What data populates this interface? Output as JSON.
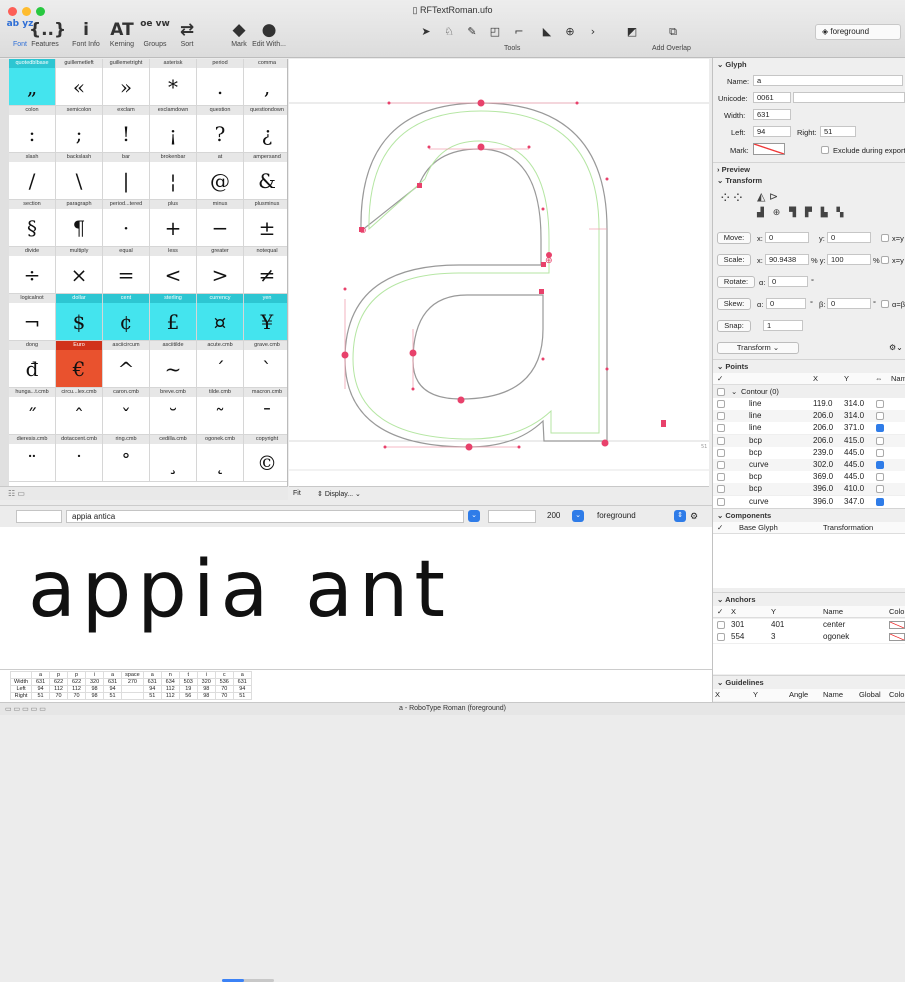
{
  "window": {
    "title": "RFTextRoman.ufo"
  },
  "toolbar": {
    "buttons": [
      {
        "label": "Font",
        "icon_text": "ab yz"
      },
      {
        "label": "Features",
        "icon_text": "{..}"
      },
      {
        "label": "Font Info",
        "icon_text": "i"
      },
      {
        "label": "Kerning",
        "icon_text": "AT"
      },
      {
        "label": "Groups",
        "icon_text": "oe vw"
      },
      {
        "label": "Sort",
        "icon_text": "⇄"
      },
      {
        "label": "Mark",
        "icon_text": "◆"
      },
      {
        "label": "Edit With...",
        "icon_text": "●"
      }
    ],
    "tools_label": "Tools",
    "add_overlap_label": "Add Overlap",
    "layer": "foreground"
  },
  "glyph_cells": [
    {
      "name": "quotedblbase",
      "glyph": "„",
      "mark": "cyan"
    },
    {
      "name": "guillemetleft",
      "glyph": "«"
    },
    {
      "name": "guillemetright",
      "glyph": "»"
    },
    {
      "name": "asterisk",
      "glyph": "*"
    },
    {
      "name": "period",
      "glyph": "."
    },
    {
      "name": "comma",
      "glyph": ","
    },
    {
      "name": "colon",
      "glyph": ":"
    },
    {
      "name": "semicolon",
      "glyph": ";"
    },
    {
      "name": "exclam",
      "glyph": "!"
    },
    {
      "name": "exclamdown",
      "glyph": "¡"
    },
    {
      "name": "question",
      "glyph": "?"
    },
    {
      "name": "questiondown",
      "glyph": "¿"
    },
    {
      "name": "slash",
      "glyph": "/"
    },
    {
      "name": "backslash",
      "glyph": "\\"
    },
    {
      "name": "bar",
      "glyph": "|"
    },
    {
      "name": "brokenbar",
      "glyph": "¦"
    },
    {
      "name": "at",
      "glyph": "@"
    },
    {
      "name": "ampersand",
      "glyph": "&"
    },
    {
      "name": "section",
      "glyph": "§"
    },
    {
      "name": "paragraph",
      "glyph": "¶"
    },
    {
      "name": "period...tered",
      "glyph": "·"
    },
    {
      "name": "plus",
      "glyph": "+"
    },
    {
      "name": "minus",
      "glyph": "−"
    },
    {
      "name": "plusminus",
      "glyph": "±"
    },
    {
      "name": "divide",
      "glyph": "÷"
    },
    {
      "name": "multiply",
      "glyph": "×"
    },
    {
      "name": "equal",
      "glyph": "="
    },
    {
      "name": "less",
      "glyph": "<"
    },
    {
      "name": "greater",
      "glyph": ">"
    },
    {
      "name": "notequal",
      "glyph": "≠"
    },
    {
      "name": "logicalnot",
      "glyph": "¬"
    },
    {
      "name": "dollar",
      "glyph": "$",
      "mark": "cyan"
    },
    {
      "name": "cent",
      "glyph": "¢",
      "mark": "cyan"
    },
    {
      "name": "sterling",
      "glyph": "£",
      "mark": "cyan"
    },
    {
      "name": "currency",
      "glyph": "¤",
      "mark": "cyan"
    },
    {
      "name": "yen",
      "glyph": "¥",
      "mark": "cyan"
    },
    {
      "name": "dong",
      "glyph": "đ"
    },
    {
      "name": "Euro",
      "glyph": "€",
      "mark": "red"
    },
    {
      "name": "asciicircum",
      "glyph": "^"
    },
    {
      "name": "asciitilde",
      "glyph": "~"
    },
    {
      "name": "acute.cmb",
      "glyph": "ˊ"
    },
    {
      "name": "grave.cmb",
      "glyph": "ˋ"
    },
    {
      "name": "hunga...t.cmb",
      "glyph": "˝"
    },
    {
      "name": "circu...lex.cmb",
      "glyph": "ˆ"
    },
    {
      "name": "caron.cmb",
      "glyph": "ˇ"
    },
    {
      "name": "breve.cmb",
      "glyph": "˘"
    },
    {
      "name": "tilde.cmb",
      "glyph": "˜"
    },
    {
      "name": "macron.cmb",
      "glyph": "¯"
    },
    {
      "name": "dieresis.cmb",
      "glyph": "¨"
    },
    {
      "name": "dotaccent.cmb",
      "glyph": "˙"
    },
    {
      "name": "ring.cmb",
      "glyph": "˚"
    },
    {
      "name": "cedilla.cmb",
      "glyph": "¸"
    },
    {
      "name": "ogonek.cmb",
      "glyph": "˛"
    },
    {
      "name": "copyright",
      "glyph": "©"
    }
  ],
  "canvas_footer": {
    "fit": "Fit",
    "display": "Display..."
  },
  "spacecenter": {
    "text": "appia antica",
    "size": "200",
    "layer": "foreground",
    "preview": "appia ant"
  },
  "metrics_table": {
    "glyphs": [
      "",
      "a",
      "p",
      "p",
      "i",
      "a",
      "space",
      "a",
      "n",
      "t",
      "i",
      "c",
      "a"
    ],
    "rows": [
      [
        "Width",
        "631",
        "622",
        "622",
        "320",
        "631",
        "270",
        "631",
        "634",
        "503",
        "320",
        "536",
        "631"
      ],
      [
        "Left",
        "94",
        "112",
        "112",
        "98",
        "94",
        "",
        "94",
        "112",
        "19",
        "98",
        "70",
        "94"
      ],
      [
        "Right",
        "51",
        "70",
        "70",
        "98",
        "51",
        "",
        "51",
        "112",
        "56",
        "98",
        "70",
        "51"
      ]
    ]
  },
  "status": "a - RoboType Roman (foreground)",
  "inspector": {
    "glyph": {
      "title": "Glyph",
      "name_label": "Name:",
      "name": "a",
      "unicode_label": "Unicode:",
      "unicode": "0061",
      "width_label": "Width:",
      "width": "631",
      "left_label": "Left:",
      "left": "94",
      "right_label": "Right:",
      "right": "51",
      "mark_label": "Mark:",
      "exclude": "Exclude during export"
    },
    "preview_title": "Preview",
    "transform": {
      "title": "Transform",
      "move": "Move:",
      "move_x": "0",
      "move_y": "0",
      "scale": "Scale:",
      "scale_x": "90.9438",
      "scale_y": "100",
      "rotate": "Rotate:",
      "rotate_v": "0",
      "skew": "Skew:",
      "skew_a": "0",
      "skew_b": "0",
      "snap": "Snap:",
      "snap_v": "1",
      "menu": "Transform"
    },
    "points": {
      "title": "Points",
      "col_x": "X",
      "col_y": "Y",
      "col_name": "Nam",
      "contour": "Contour (0)",
      "rows": [
        {
          "type": "line",
          "x": "119.0",
          "y": "314.0",
          "checked": false
        },
        {
          "type": "line",
          "x": "206.0",
          "y": "314.0",
          "checked": false
        },
        {
          "type": "line",
          "x": "206.0",
          "y": "371.0",
          "checked": true
        },
        {
          "type": "bcp",
          "x": "206.0",
          "y": "415.0",
          "checked": false
        },
        {
          "type": "bcp",
          "x": "239.0",
          "y": "445.0",
          "checked": false
        },
        {
          "type": "curve",
          "x": "302.0",
          "y": "445.0",
          "checked": true
        },
        {
          "type": "bcp",
          "x": "369.0",
          "y": "445.0",
          "checked": false
        },
        {
          "type": "bcp",
          "x": "396.0",
          "y": "410.0",
          "checked": false
        },
        {
          "type": "curve",
          "x": "396.0",
          "y": "347.0",
          "checked": true
        }
      ]
    },
    "components": {
      "title": "Components",
      "col1": "Base Glyph",
      "col2": "Transformation"
    },
    "anchors": {
      "title": "Anchors",
      "col_x": "X",
      "col_y": "Y",
      "col_name": "Name",
      "col_color": "Colo",
      "rows": [
        {
          "x": "301",
          "y": "401",
          "name": "center"
        },
        {
          "x": "554",
          "y": "3",
          "name": "ogonek"
        }
      ]
    },
    "guidelines": {
      "title": "Guidelines",
      "cols": [
        "X",
        "Y",
        "Angle",
        "Name",
        "Global",
        "Colo"
      ]
    }
  }
}
